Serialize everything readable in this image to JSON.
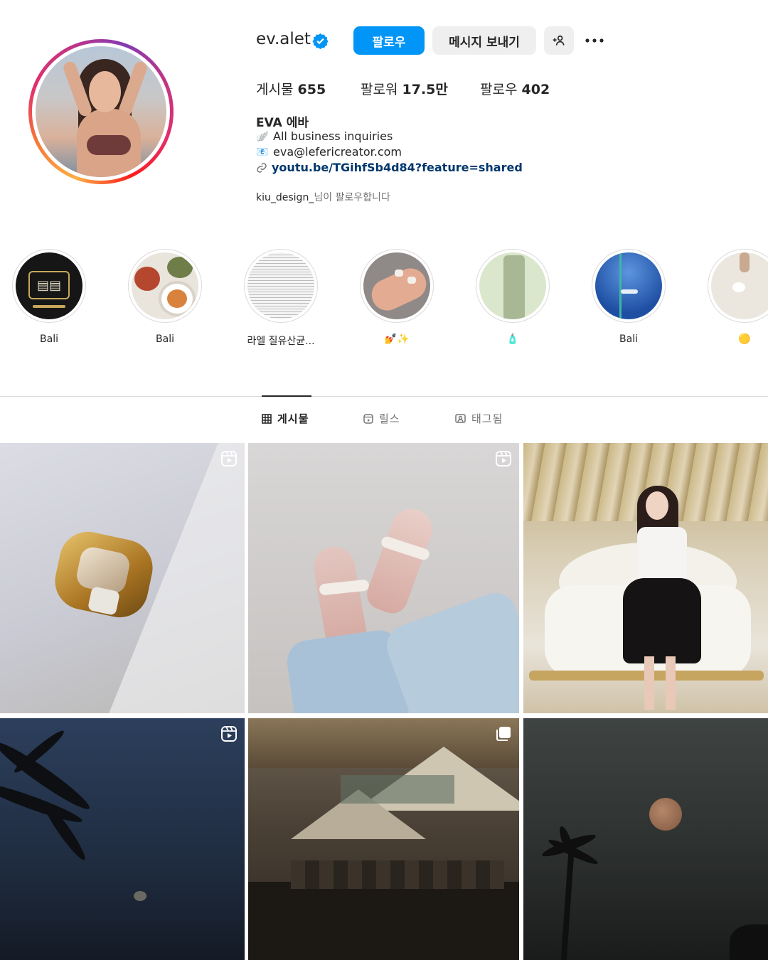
{
  "profile": {
    "username": "ev.alet",
    "follow_label": "팔로우",
    "message_label": "메시지 보내기",
    "stats": {
      "posts_label": "게시물",
      "posts_value": "655",
      "followers_label": "팔로워",
      "followers_value": "17.5만",
      "following_label": "팔로우",
      "following_value": "402"
    },
    "full_name": "EVA 에바",
    "bio": [
      {
        "icon": "🪽",
        "text": "All business inquiries"
      },
      {
        "icon": "📧",
        "text": "eva@lefericreator.com"
      }
    ],
    "link": "youtu.be/TGihfSb4d84?feature=shared",
    "followed_by_user": "kiu_design_",
    "followed_by_suffix": "님이 팔로우합니다"
  },
  "highlights": [
    {
      "label": "Bali"
    },
    {
      "label": "Bali"
    },
    {
      "label": "라엘 질유산균..."
    },
    {
      "label": "💅✨"
    },
    {
      "label": "🧴"
    },
    {
      "label": "Bali"
    },
    {
      "label": "🟡"
    }
  ],
  "tabs": [
    {
      "label": "게시물",
      "icon": "grid-icon",
      "active": true
    },
    {
      "label": "릴스",
      "icon": "reels-icon",
      "active": false
    },
    {
      "label": "태그됨",
      "icon": "tagged-icon",
      "active": false
    }
  ],
  "colors": {
    "accent": "#0095f6",
    "link": "#00376b",
    "muted": "#737373"
  }
}
